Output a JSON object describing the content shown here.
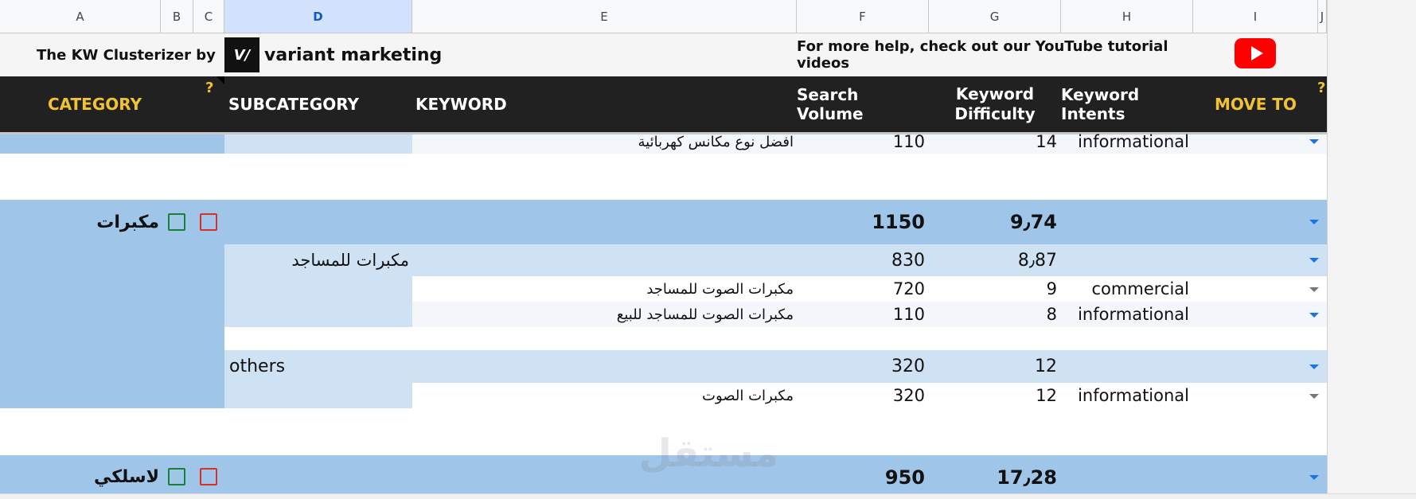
{
  "column_headers": [
    "A",
    "B",
    "C",
    "D",
    "E",
    "F",
    "G",
    "H",
    "I",
    "J"
  ],
  "top_bar": {
    "title": "The KW Clusterizer by",
    "brand_mark": "V/",
    "brand_name": "variant marketing",
    "help_text": "For more help, check out our YouTube tutorial videos"
  },
  "header": {
    "category": "CATEGORY",
    "help_mark": "?",
    "subcategory": "SUBCATEGORY",
    "keyword": "KEYWORD",
    "search_volume": "Search Volume",
    "kd_line1": "Keyword",
    "kd_line2": "Difficulty",
    "intents": "Keyword Intents",
    "move_to": "MOVE TO",
    "help_mark2": "?"
  },
  "rows": {
    "top_keyword": "افضل نوع مكانس كهربائية",
    "top_volume": "110",
    "top_kd": "14",
    "top_intent": "informational",
    "cat1_name": "مكبرات",
    "cat1_volume": "1150",
    "cat1_kd": "9٫74",
    "sub1_name": "مكبرات للمساجد",
    "sub1_volume": "830",
    "sub1_kd": "8٫87",
    "kw1": "مكبرات الصوت للمساجد",
    "kw1_volume": "720",
    "kw1_kd": "9",
    "kw1_intent": "commercial",
    "kw2": "مكبرات الصوت للمساجد للبيع",
    "kw2_volume": "110",
    "kw2_kd": "8",
    "kw2_intent": "informational",
    "sub2_name": "others",
    "sub2_volume": "320",
    "sub2_kd": "12",
    "kw3": "مكبرات الصوت",
    "kw3_volume": "320",
    "kw3_kd": "12",
    "kw3_intent": "informational",
    "cat2_name": "لاسلكي",
    "cat2_volume": "950",
    "cat2_kd": "17٫28"
  },
  "watermark": "مستقل",
  "colors": {
    "dark_header": "#212121",
    "accent_yellow": "#f1c232",
    "category_blue": "#9fc5e8",
    "subcategory_blue": "#cfe2f3",
    "keyword_row": "#f3f6fb",
    "youtube_red": "#ff0000"
  }
}
